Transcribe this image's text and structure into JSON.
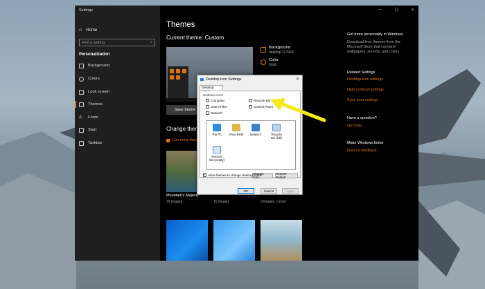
{
  "window": {
    "title": "Settings",
    "controls": [
      "—",
      "☐",
      "✕"
    ]
  },
  "sidebar": {
    "home": "Home",
    "search_placeholder": "Find a setting",
    "section": "Personalization",
    "items": [
      {
        "label": "Background",
        "icon": "image-icon"
      },
      {
        "label": "Colors",
        "icon": "palette-icon"
      },
      {
        "label": "Lock screen",
        "icon": "lock-screen-icon"
      },
      {
        "label": "Themes",
        "icon": "themes-icon",
        "active": true
      },
      {
        "label": "Fonts",
        "icon": "fonts-icon"
      },
      {
        "label": "Start",
        "icon": "start-icon"
      },
      {
        "label": "Taskbar",
        "icon": "taskbar-icon"
      }
    ]
  },
  "main": {
    "title": "Themes",
    "current_theme": "Current theme: Custom",
    "save_theme": "Save theme",
    "background_label": "Background",
    "background_value": "desktop 127960",
    "color_label": "Color",
    "color_value": "Gold",
    "change_theme": "Change theme",
    "get_more": "Get more themes in Microsoft Store",
    "tiles": [
      {
        "name": "Mountain's Majesty",
        "sub": "16 images"
      },
      {
        "name": "",
        "sub": "16 images"
      },
      {
        "name": "",
        "sub": "3 images, cursor"
      }
    ]
  },
  "right": {
    "store_heading": "Get more personality in Windows",
    "store_desc": "Download free themes from the Microsoft Store that combine wallpapers, sounds, and colors",
    "related_heading": "Related Settings",
    "related_links": [
      "Desktop icon settings",
      "High contrast settings",
      "Sync your settings"
    ],
    "question_heading": "Have a question?",
    "question_link": "Get help",
    "better_heading": "Make Windows better",
    "better_link": "Give us feedback"
  },
  "dialog": {
    "title": "Desktop Icon Settings",
    "tab": "Desktop Icons",
    "group": "Desktop icons",
    "checkboxes": [
      {
        "label": "Computer",
        "checked": false
      },
      {
        "label": "Recycle Bin",
        "checked": false
      },
      {
        "label": "User's Files",
        "checked": false
      },
      {
        "label": "Control Panel",
        "checked": false
      },
      {
        "label": "Network",
        "checked": false
      }
    ],
    "icons": [
      {
        "label": "The PC"
      },
      {
        "label": "Ahsa Eleth"
      },
      {
        "label": "Network"
      },
      {
        "label": "Recycle Bin (full)"
      },
      {
        "label": "Recycle Bin (empty)"
      }
    ],
    "change_icon": "Change Icon...",
    "restore_default": "Restore Default",
    "allow_label": "Allow themes to change desktop icons",
    "ok": "OK",
    "cancel": "Cancel",
    "apply": "Apply"
  },
  "colors": {
    "accent": "#e07200",
    "highlight_arrow": "#f4ea1a"
  }
}
